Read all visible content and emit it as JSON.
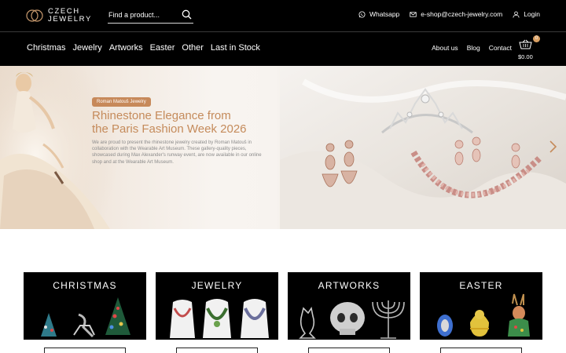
{
  "brand": {
    "line1": "CZECH",
    "line2": "JEWELRY"
  },
  "search": {
    "placeholder": "Find a product..."
  },
  "top_links": {
    "whatsapp": "Whatsapp",
    "email": "e-shop@czech-jewelry.com",
    "login": "Login"
  },
  "main_nav": [
    "Christmas",
    "Jewelry",
    "Artworks",
    "Easter",
    "Other",
    "Last in Stock"
  ],
  "sub_nav": [
    "About us",
    "Blog",
    "Contact"
  ],
  "cart": {
    "count": "0",
    "total": "$0.00"
  },
  "hero": {
    "tag": "Roman Matouš Jewelry",
    "title_line1": "Rhinestone Elegance from",
    "title_line2": "the Paris Fashion Week 2026",
    "text": "We are proud to present the rhinestone jewelry created by Roman Matouš in collaboration with the Wearable Art Museum. These gallery-quality pieces, showcased during Max Alexander's runway event, are now available in our online shop and at the Wearable Art Museum."
  },
  "categories": [
    "CHRISTMAS",
    "JEWELRY",
    "ARTWORKS",
    "EASTER"
  ],
  "colors": {
    "accent": "#c58b5b",
    "badge": "#d9a063",
    "bar": "#000000"
  },
  "icons": [
    "logo-mark-icon",
    "search-icon",
    "whatsapp-icon",
    "mail-icon",
    "user-icon",
    "cart-icon",
    "chevron-right-icon"
  ]
}
